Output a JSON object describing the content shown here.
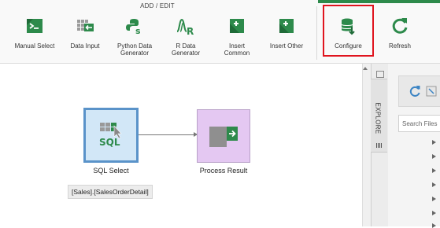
{
  "ribbon": {
    "group_label": "ADD / EDIT",
    "buttons": [
      {
        "id": "manual-select",
        "label": "Manual Select",
        "icon": "manual-select-icon"
      },
      {
        "id": "data-input",
        "label": "Data Input",
        "icon": "data-input-icon"
      },
      {
        "id": "python-data-generator",
        "label": "Python Data\nGenerator",
        "icon": "python-icon"
      },
      {
        "id": "r-data-generator",
        "label": "R Data\nGenerator",
        "icon": "r-icon"
      },
      {
        "id": "insert-common",
        "label": "Insert\nCommon",
        "icon": "insert-icon",
        "dropdown": true
      },
      {
        "id": "insert-other",
        "label": "Insert Other",
        "icon": "insert-icon",
        "dropdown": true
      },
      {
        "id": "configure",
        "label": "Configure",
        "icon": "configure-icon"
      },
      {
        "id": "refresh",
        "label": "Refresh",
        "icon": "refresh-icon"
      }
    ],
    "accent": "#2d8a4b",
    "highlight_color": "#e0141e"
  },
  "canvas": {
    "nodes": [
      {
        "label": "SQL Select",
        "detail": "[Sales].[SalesOrderDetail]",
        "icon": "sql-icon",
        "selected": true
      },
      {
        "label": "Process Result",
        "icon": "process-result-icon"
      }
    ]
  },
  "panel": {
    "tab_label": "EXPLORE",
    "search_placeholder": "Search Files",
    "tree_item_count": 7
  }
}
